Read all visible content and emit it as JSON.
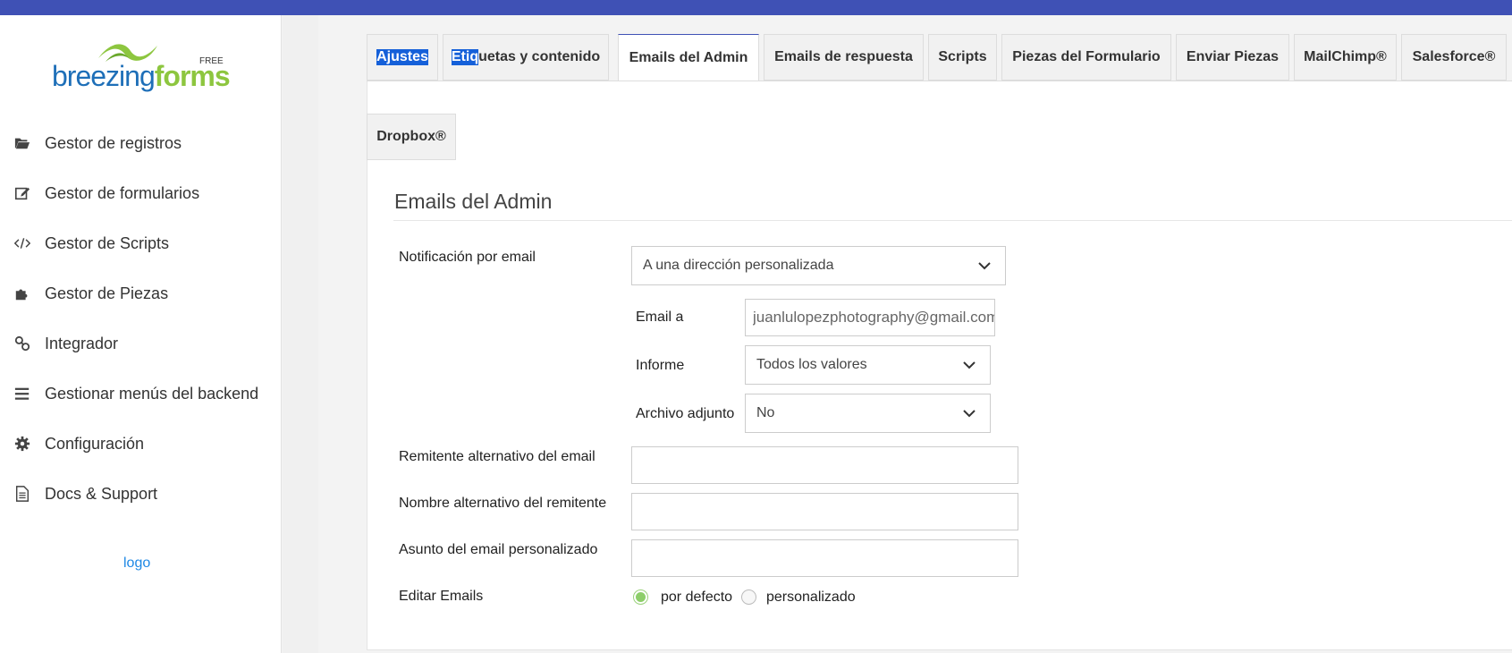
{
  "brand": {
    "name_part1": "breezing",
    "name_part2": "forms",
    "edition": "FREE",
    "color_blue": "#1e6fb8",
    "color_green": "#8dc63f"
  },
  "topbar": {
    "color": "#3f51b5"
  },
  "sidebar": {
    "items": [
      {
        "label": "Gestor de registros",
        "icon": "folder-open-icon"
      },
      {
        "label": "Gestor de formularios",
        "icon": "edit-icon"
      },
      {
        "label": "Gestor de Scripts",
        "icon": "code-icon"
      },
      {
        "label": "Gestor de Piezas",
        "icon": "puzzle-icon"
      },
      {
        "label": "Integrador",
        "icon": "link-icon"
      },
      {
        "label": "Gestionar menús del backend",
        "icon": "bars-icon"
      },
      {
        "label": "Configuración",
        "icon": "gear-icon"
      },
      {
        "label": "Docs & Support",
        "icon": "document-icon"
      }
    ],
    "logo_link": "logo"
  },
  "tabs": [
    {
      "label": "Ajustes",
      "active": false
    },
    {
      "label_selected": "Etiq",
      "label_rest": "uetas y contenido",
      "active": false
    },
    {
      "label": "Emails del Admin",
      "active": true
    },
    {
      "label": "Emails de respuesta",
      "active": false
    },
    {
      "label": "Scripts",
      "active": false
    },
    {
      "label": "Piezas del Formulario",
      "active": false
    },
    {
      "label": "Enviar Piezas",
      "active": false
    },
    {
      "label": "MailChimp®",
      "active": false
    },
    {
      "label": "Salesforce®",
      "active": false
    },
    {
      "label": "Dropbox®",
      "active": false
    }
  ],
  "section": {
    "title": "Emails del Admin",
    "notification": {
      "label": "Notificación por email",
      "value": "A una dirección personalizada"
    },
    "email_to": {
      "label": "Email a",
      "value": "juanlulopezphotography@gmail.com"
    },
    "report": {
      "label": "Informe",
      "value": "Todos los valores"
    },
    "attachment": {
      "label": "Archivo adjunto",
      "value": "No"
    },
    "alt_sender": {
      "label": "Remitente alternativo del email",
      "value": ""
    },
    "alt_sender_name": {
      "label": "Nombre alternativo del remitente",
      "value": ""
    },
    "custom_subject": {
      "label": "Asunto del email personalizado",
      "value": ""
    },
    "edit_emails": {
      "label": "Editar Emails",
      "options": [
        {
          "label": "por defecto",
          "checked": true
        },
        {
          "label": "personalizado",
          "checked": false
        }
      ]
    }
  }
}
